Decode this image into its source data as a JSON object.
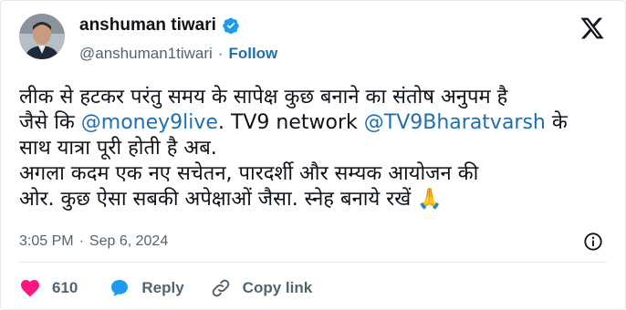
{
  "author": {
    "name": "anshuman tiwari",
    "handle": "@anshuman1tiwari",
    "separator": "·",
    "follow_label": "Follow"
  },
  "tweet": {
    "line1": "लीक से हटकर परंतु समय के सापेक्ष कुछ बनाने का संतोष अनुपम है",
    "line2_prefix": "जैसे कि ",
    "mention1": "@money9live",
    "line2_middle": ". TV9 network ",
    "mention2": "@TV9Bharatvarsh",
    "line2_suffix": " के",
    "line3": "साथ यात्रा पूरी होती है अब.",
    "line4": "अगला कदम  एक नए सचेतन, पारदर्शी और सम्यक आयोजन की",
    "line5": "ओर. कुछ ऐसा सबकी अपेक्षाओं जैसा. स्नेह बनाये रखें 🙏"
  },
  "meta": {
    "time": "3:05 PM",
    "separator": "·",
    "date": "Sep 6, 2024"
  },
  "actions": {
    "likes_count": "610",
    "reply_label": "Reply",
    "copy_link_label": "Copy link"
  },
  "colors": {
    "accent": "#1d9bf0",
    "link": "#1d6fb3",
    "heart": "#f91880",
    "muted": "#536471"
  }
}
